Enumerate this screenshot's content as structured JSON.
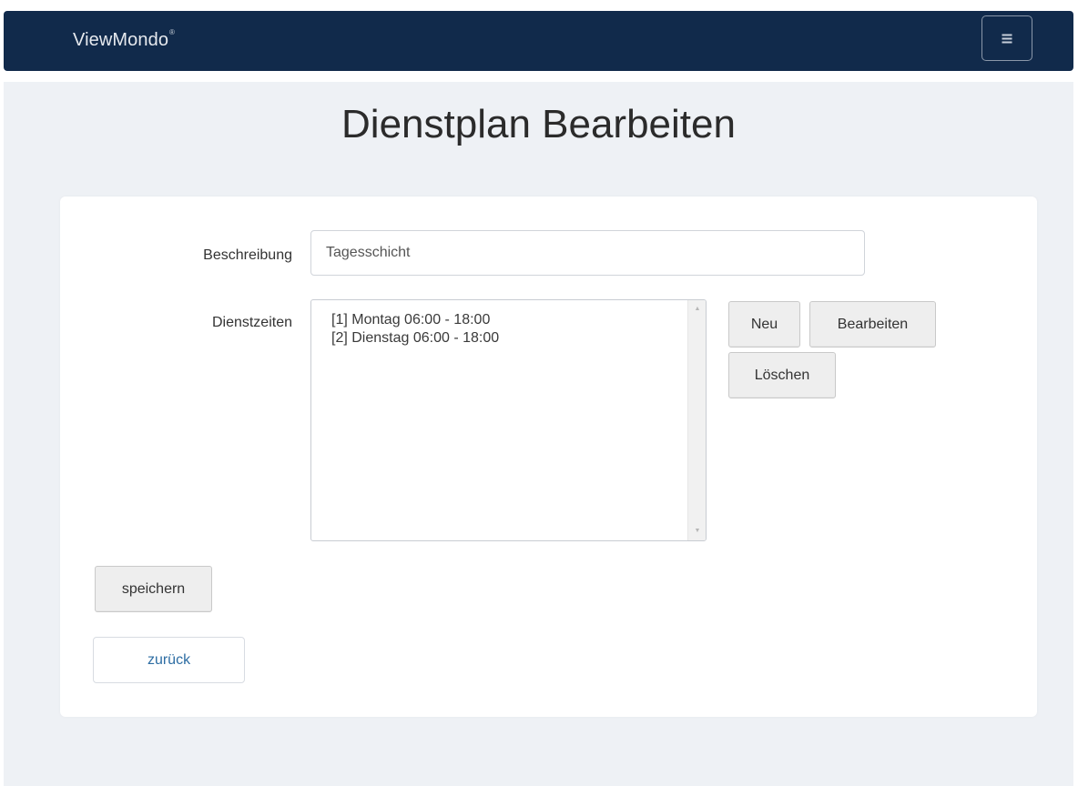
{
  "navbar": {
    "brand": "ViewMondo",
    "brand_mark": "®",
    "menu_icon": "hamburger-icon"
  },
  "page": {
    "title": "Dienstplan Bearbeiten"
  },
  "form": {
    "beschreibung_label": "Beschreibung",
    "beschreibung_value": "Tagesschicht",
    "dienstzeiten_label": "Dienstzeiten",
    "dienstzeiten_items": [
      "[1] Montag 06:00 - 18:00",
      "[2] Dienstag 06:00 - 18:00"
    ]
  },
  "buttons": {
    "neu": "Neu",
    "bearbeiten": "Bearbeiten",
    "loeschen": "Löschen",
    "speichern": "speichern",
    "zurueck": "zurück"
  },
  "colors": {
    "navbar_bg": "#112a4b",
    "page_bg": "#eef1f5",
    "link": "#2d6da3"
  }
}
